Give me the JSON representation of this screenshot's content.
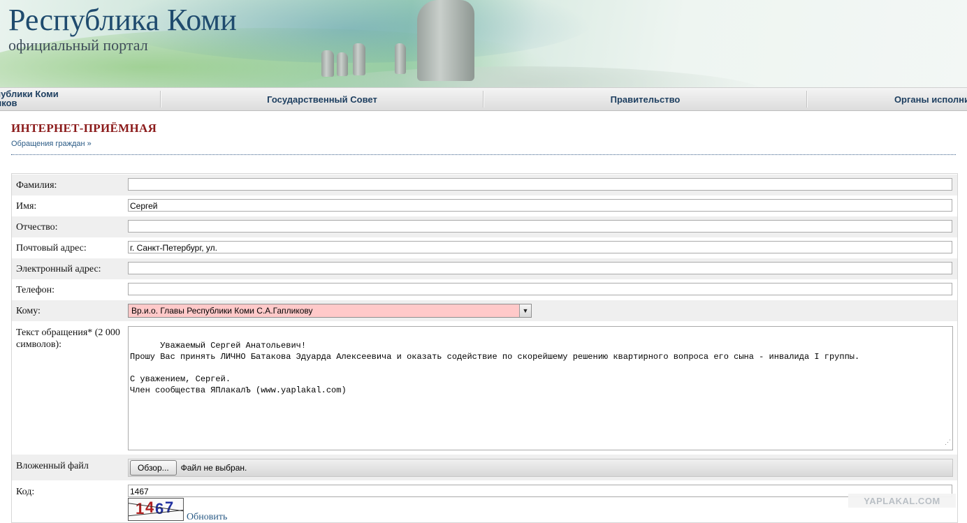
{
  "header": {
    "title": "Республика Коми",
    "subtitle": "официальный портал"
  },
  "nav": {
    "items": [
      {
        "line1": "спублики Коми",
        "line2": "ликов"
      },
      {
        "label": "Государственный Совет"
      },
      {
        "label": "Правительство"
      },
      {
        "label": "Органы исполни"
      }
    ]
  },
  "page": {
    "title": "ИНТЕРНЕТ-ПРИЁМНАЯ",
    "breadcrumb": "Обращения граждан »"
  },
  "form": {
    "surname": {
      "label": "Фамилия:",
      "value": ""
    },
    "name": {
      "label": "Имя:",
      "value": "Сергей"
    },
    "patronymic": {
      "label": "Отчество:",
      "value": ""
    },
    "postal": {
      "label": "Почтовый адрес:",
      "value": "г. Санкт-Петербург, ул."
    },
    "email": {
      "label": "Электронный адрес:",
      "value": ""
    },
    "phone": {
      "label": "Телефон:",
      "value": ""
    },
    "to": {
      "label": "Кому:",
      "value": "Вр.и.о. Главы Республики Коми С.А.Гапликову"
    },
    "message": {
      "label": "Текст обращения* (2 000 символов):",
      "text": "Уважаемый Сергей Анатольевич!\nПрошу Вас принять ЛИЧНО Батакова Эдуарда Алексеевича и оказать содействие по скорейшему решению квартирного вопроса его сына - инвалида I группы.\n\nС уважением, Сергей.\nЧлен сообщества ЯПлакалЪ (www.yaplakal.com)"
    },
    "file": {
      "label": "Вложенный файл",
      "button": "Обзор...",
      "status": "Файл не выбран."
    },
    "code": {
      "label": "Код:",
      "value": "1467",
      "captcha": [
        "1",
        "4",
        "6",
        "7"
      ],
      "refresh": "Обновить"
    }
  },
  "watermark": "YAPLAKAL.COM"
}
